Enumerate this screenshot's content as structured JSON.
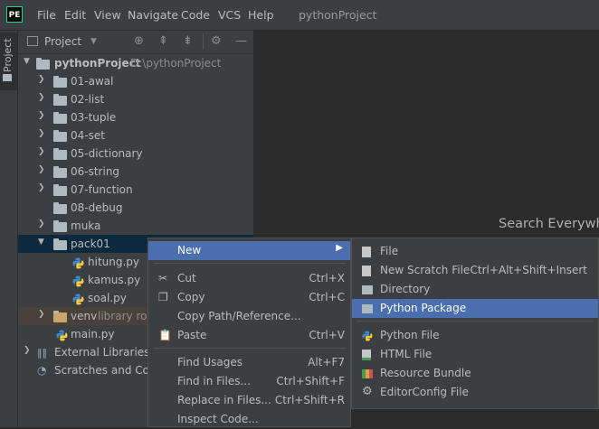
{
  "menubar": {
    "logo": "PE",
    "items": [
      "File",
      "Edit",
      "View",
      "Navigate",
      "Code",
      "VCS",
      "Help"
    ],
    "title": "pythonProject"
  },
  "stripe": {
    "label": "Project"
  },
  "panel": {
    "title": "Project"
  },
  "tree": {
    "root": {
      "name": "pythonProject",
      "path": "D:\\pythonProject"
    },
    "folders": [
      "01-awal",
      "02-list",
      "03-tuple",
      "04-set",
      "05-dictionary",
      "06-string",
      "07-function",
      "08-debug",
      "muka"
    ],
    "pack": "pack01",
    "pack_files": [
      "hitung.py",
      "kamus.py",
      "soal.py"
    ],
    "venv": "venv",
    "venv_note": "library roo",
    "main": "main.py",
    "external": "External Libraries",
    "scratches": "Scratches and Cons"
  },
  "editor": {
    "hint": "Search Everywh"
  },
  "context_menu": {
    "items": [
      {
        "label": "New",
        "shortcut": ""
      },
      {
        "label": "Cut",
        "shortcut": "Ctrl+X"
      },
      {
        "label": "Copy",
        "shortcut": "Ctrl+C"
      },
      {
        "label": "Copy Path/Reference...",
        "shortcut": ""
      },
      {
        "label": "Paste",
        "shortcut": "Ctrl+V"
      },
      {
        "label": "Find Usages",
        "shortcut": "Alt+F7"
      },
      {
        "label": "Find in Files...",
        "shortcut": "Ctrl+Shift+F"
      },
      {
        "label": "Replace in Files...",
        "shortcut": "Ctrl+Shift+R"
      },
      {
        "label": "Inspect Code...",
        "shortcut": ""
      }
    ]
  },
  "submenu": {
    "items": [
      {
        "label": "File",
        "shortcut": ""
      },
      {
        "label": "New Scratch File",
        "shortcut": "Ctrl+Alt+Shift+Insert"
      },
      {
        "label": "Directory",
        "shortcut": ""
      },
      {
        "label": "Python Package",
        "shortcut": ""
      },
      {
        "label": "Python File",
        "shortcut": ""
      },
      {
        "label": "HTML File",
        "shortcut": ""
      },
      {
        "label": "Resource Bundle",
        "shortcut": ""
      },
      {
        "label": "EditorConfig File",
        "shortcut": ""
      }
    ]
  },
  "colors": {
    "selection": "#4b6eaf",
    "panel": "#3c3f41",
    "editor": "#2b2b2b"
  }
}
